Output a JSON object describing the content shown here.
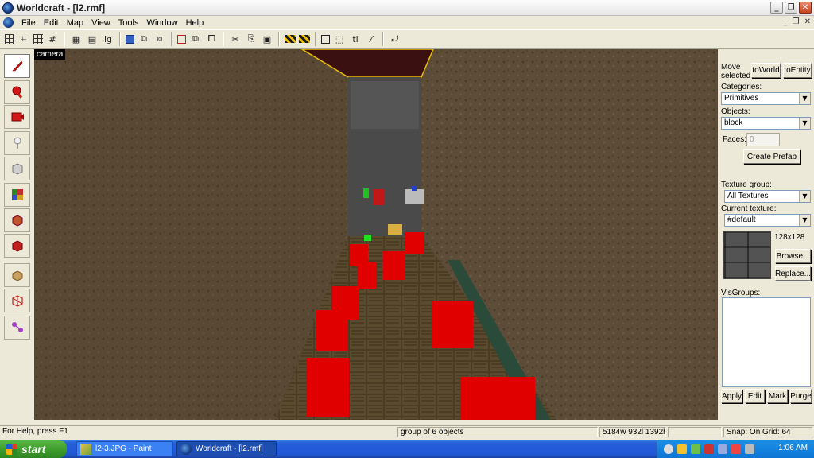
{
  "window": {
    "title": "Worldcraft - [l2.rmf]"
  },
  "menu": [
    "File",
    "Edit",
    "Map",
    "View",
    "Tools",
    "Window",
    "Help"
  ],
  "toolbar": {
    "texture_lock_label": "tl",
    "toggle_ig_label": "ig"
  },
  "viewport": {
    "label": "camera"
  },
  "panel": {
    "move_selected_label": "Move selected:",
    "to_world": "toWorld",
    "to_entity": "toEntity",
    "categories_label": "Categories:",
    "categories_value": "Primitives",
    "objects_label": "Objects:",
    "objects_value": "block",
    "faces_label": "Faces:",
    "faces_value": "0",
    "create_prefab": "Create Prefab",
    "texture_group_label": "Texture group:",
    "texture_group_value": "All Textures",
    "current_texture_label": "Current texture:",
    "current_texture_value": "#default",
    "texture_size": "128x128",
    "browse": "Browse...",
    "replace": "Replace...",
    "visgroups_label": "VisGroups:",
    "apply": "Apply",
    "edit": "Edit",
    "mark": "Mark",
    "purge": "Purge"
  },
  "status": {
    "help": "For Help, press F1",
    "selection": "group of 6 objects",
    "size": "5184w 932l 1392h",
    "snap": "Snap: On Grid: 64"
  },
  "taskbar": {
    "start": "start",
    "task1": "l2-3.JPG - Paint",
    "task2": "Worldcraft - [l2.rmf]",
    "clock": "1:06 AM"
  },
  "icons": {
    "toolbox": [
      "selection-tool-icon",
      "magnify-tool-icon",
      "camera-tool-icon",
      "entity-tool-icon",
      "block-tool-icon",
      "texture-tool-icon",
      "apply-texture-icon",
      "decal-tool-icon",
      "clip-tool-icon",
      "vertex-tool-icon",
      "path-tool-icon"
    ]
  },
  "colors": {
    "red_blocks": "#e00000",
    "floor_text": "#FERN"
  }
}
